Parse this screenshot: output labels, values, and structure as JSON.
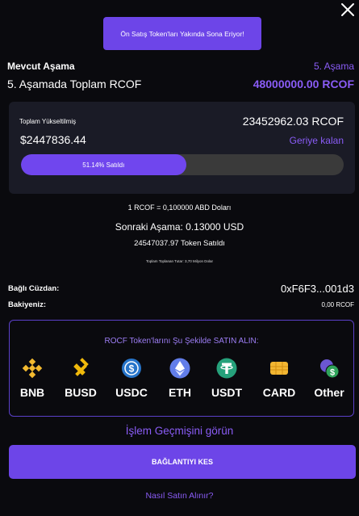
{
  "banner": {
    "text": "Ön Satış Token'ları Yakında Sona Eriyor!"
  },
  "stage": {
    "current_label": "Mevcut Aşama",
    "current_value": "5. Aşama",
    "total_label": "5. Aşamada Toplam RCOF",
    "total_value": "48000000.00 RCOF"
  },
  "raised": {
    "label": "Toplam Yükseltilmiş",
    "tokens": "23452962.03 RCOF",
    "usd": "$2447836.44",
    "remaining_label": "Geriye kalan",
    "progress_text": "51.14% Satıldı",
    "progress_percent": 51.14
  },
  "info": {
    "rate": "1 RCOF = 0,100000 ABD Doları",
    "next_stage": "Sonraki Aşama: 0.13000 USD",
    "tokens_sold": "24547037.97 Token Satıldı",
    "total_collected": "Toplam Toplanan Tutar: 3,70 Milyon Dolar"
  },
  "wallet": {
    "connected_label": "Bağlı Cüzdan:",
    "address": "0xF6F3...001d3",
    "balance_label": "Bakiyeniz:",
    "balance_value": "0,00 RCOF"
  },
  "buy": {
    "title": "ROCF Token'larını Şu Şekilde SATIN ALIN:",
    "options": [
      {
        "name": "BNB",
        "icon": "bnb-icon",
        "color": "#F3BA2F"
      },
      {
        "name": "BUSD",
        "icon": "busd-icon",
        "color": "#F0B90B"
      },
      {
        "name": "USDC",
        "icon": "usdc-icon",
        "color": "#2775CA"
      },
      {
        "name": "ETH",
        "icon": "eth-icon",
        "color": "#627EEA"
      },
      {
        "name": "USDT",
        "icon": "usdt-icon",
        "color": "#26A17B"
      },
      {
        "name": "CARD",
        "icon": "card-icon",
        "color": "#F2B632"
      },
      {
        "name": "Other",
        "icon": "other-coins-icon",
        "color": "#6B57D2"
      }
    ]
  },
  "actions": {
    "history": "İşlem Geçmişini görün",
    "disconnect": "BAĞLANTIYI KES",
    "how_to": "Nasıl Satın Alınır?"
  },
  "colors": {
    "accent": "#6D45E8",
    "accent_text": "#8A5CF6",
    "background": "#0A0A0E",
    "card": "#1A1B26"
  }
}
